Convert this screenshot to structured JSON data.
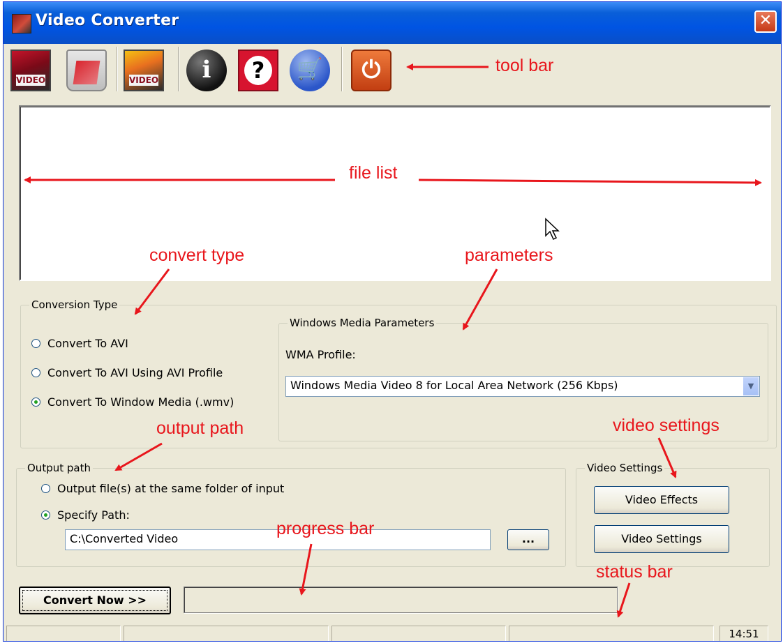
{
  "window": {
    "title": "Video Converter",
    "close_glyph": "✕"
  },
  "toolbar": {
    "buttons": [
      {
        "icon": "add-video-icon",
        "badge": "VIDEO"
      },
      {
        "icon": "trash-icon"
      },
      {
        "icon": "play-video-icon",
        "badge": "VIDEO"
      },
      {
        "icon": "info-icon",
        "glyph": "i"
      },
      {
        "icon": "help-icon",
        "glyph": "?"
      },
      {
        "icon": "shopping-cart-icon",
        "glyph": "🛒"
      },
      {
        "icon": "power-icon",
        "glyph": "⏻"
      }
    ]
  },
  "annotations": {
    "tool_bar": "tool bar",
    "file_list": "file list",
    "convert_type": "convert type",
    "parameters": "parameters",
    "output_path": "output path",
    "video_settings": "video settings",
    "progress_bar": "progress bar",
    "status_bar": "status bar",
    "color": "#e8161c"
  },
  "conversion_type": {
    "label": "Conversion Type",
    "options": [
      {
        "label": "Convert To AVI",
        "selected": false
      },
      {
        "label": "Convert To AVI Using AVI Profile",
        "selected": false
      },
      {
        "label": "Convert To Window Media (.wmv)",
        "selected": true
      }
    ]
  },
  "wm_params": {
    "label": "Windows Media Parameters",
    "profile_label": "WMA Profile:",
    "profile_value": "Windows Media Video 8 for Local Area Network (256 Kbps)"
  },
  "output_path": {
    "label": "Output path",
    "options": [
      {
        "label": "Output file(s) at the same folder of input",
        "selected": false
      },
      {
        "label": "Specify Path:",
        "selected": true
      }
    ],
    "path_value": "C:\\Converted Video",
    "browse_label": "..."
  },
  "video_settings": {
    "label": "Video Settings",
    "effects_button": "Video Effects",
    "settings_button": "Video Settings"
  },
  "convert_button": "Convert Now >>",
  "progress": 0,
  "status_bar": {
    "time": "14:51"
  }
}
